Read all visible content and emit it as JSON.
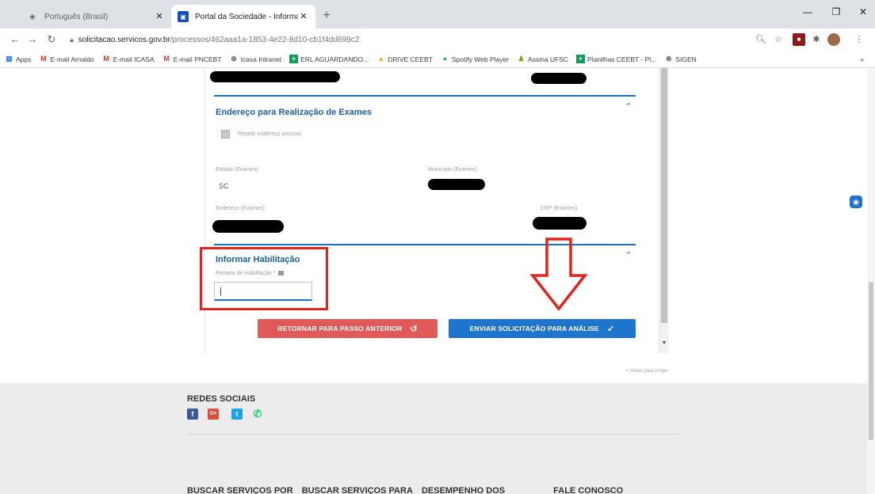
{
  "browser": {
    "tabs": [
      {
        "title": "Português (Brasil)",
        "active": false
      },
      {
        "title": "Portal da Sociedade - Informar Ti",
        "active": true
      }
    ],
    "url_host": "solicitacao.servicos.gov.br",
    "url_path": "/processos/462aaa1a-1853-4e22-8d10-cb1f4dd699c2",
    "bookmarks": [
      {
        "label": "Apps",
        "icon": "apps-icon",
        "color": "#4285f4"
      },
      {
        "label": "E-mail Arnaldo",
        "icon": "gmail-icon",
        "color": "#d93025"
      },
      {
        "label": "E-mail ICASA",
        "icon": "gmail-icon",
        "color": "#d93025"
      },
      {
        "label": "E-mail PNCEBT",
        "icon": "gmail-icon",
        "color": "#d93025"
      },
      {
        "label": "Icasa Intranet",
        "icon": "globe-icon",
        "color": "#5f6368"
      },
      {
        "label": "ERL AGUARDANDO...",
        "icon": "sheets-icon",
        "color": "#0f9d58"
      },
      {
        "label": "DRIVE CEEBT",
        "icon": "drive-icon",
        "color": "#f4b400"
      },
      {
        "label": "Spotify Web Player",
        "icon": "spotify-icon",
        "color": "#1db954"
      },
      {
        "label": "Assina UFSC",
        "icon": "assina-icon",
        "color": "#8a9a20"
      },
      {
        "label": "Planilhas CEEBT - Pl...",
        "icon": "sheets-icon",
        "color": "#0f9d58"
      },
      {
        "label": "SIGEN",
        "icon": "globe-icon",
        "color": "#5f6368"
      }
    ]
  },
  "form": {
    "exam_section": {
      "title": "Endereço para Realização de Exames",
      "repeat_address_label": "Repetir endereço pessoal",
      "state_label": "Estado (Exames)",
      "state_value": "SC",
      "city_label": "Município (Exames)",
      "address_label": "Endereço (Exames)",
      "cep_label": "CEP (Exames)"
    },
    "license_section": {
      "title": "Informar Habilitação",
      "field_label": "Portaria de Habilitação *",
      "field_value": "|"
    },
    "buttons": {
      "back": "RETORNAR PARA PASSO ANTERIOR",
      "send": "ENVIAR SOLICITAÇÃO PARA ANÁLISE"
    },
    "back_to_top": "+ Voltar para o topo"
  },
  "footer": {
    "social_title": "REDES SOCIAIS",
    "social": [
      {
        "name": "facebook-icon",
        "glyph": "f",
        "color": "#3b5998"
      },
      {
        "name": "google-plus-icon",
        "glyph": "G+",
        "color": "#dd4b39"
      },
      {
        "name": "twitter-icon",
        "glyph": "t",
        "color": "#1da1f2"
      },
      {
        "name": "whatsapp-icon",
        "glyph": "✆",
        "color": "#25d366"
      }
    ],
    "links": [
      "BUSCAR SERVIÇOS POR",
      "BUSCAR SERVIÇOS PARA",
      "DESEMPENHO DOS",
      "FALE CONOSCO"
    ]
  },
  "annotation_color": "#e0231b"
}
